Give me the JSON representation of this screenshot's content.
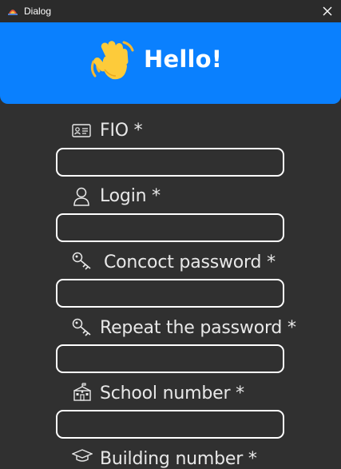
{
  "window": {
    "title": "Dialog"
  },
  "banner": {
    "emoji": "👋",
    "title": "Hello!"
  },
  "fields": [
    {
      "label": "FIO *",
      "icon": "id-card-icon",
      "value": ""
    },
    {
      "label": "Login *",
      "icon": "user-icon",
      "value": ""
    },
    {
      "label": "Concoct password *",
      "icon": "key-icon",
      "value": ""
    },
    {
      "label": "Repeat the password *",
      "icon": "key-icon",
      "value": ""
    },
    {
      "label": "School number *",
      "icon": "school-icon",
      "value": ""
    },
    {
      "label": "Building number *",
      "icon": "graduation-cap-icon",
      "value": ""
    }
  ],
  "colors": {
    "background": "#303030",
    "titlebar": "#2b2b2b",
    "banner": "#0a80fe",
    "input_border": "#ffffff",
    "label_text": "#e8e8e8"
  }
}
